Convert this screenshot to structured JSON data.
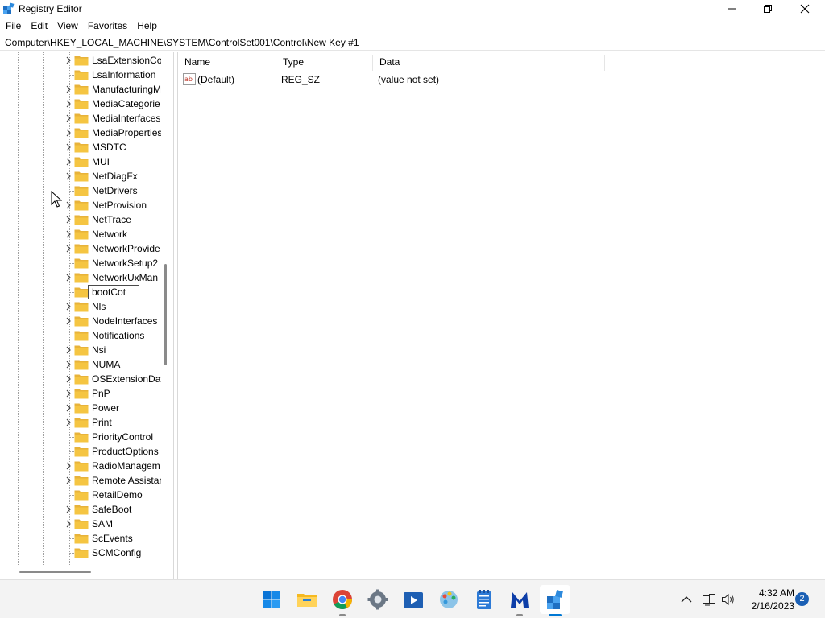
{
  "window": {
    "title": "Registry Editor",
    "minimize_icon": "minimize-icon",
    "maximize_icon": "restore-icon",
    "close_icon": "close-icon"
  },
  "menu": [
    "File",
    "Edit",
    "View",
    "Favorites",
    "Help"
  ],
  "address": "Computer\\HKEY_LOCAL_MACHINE\\SYSTEM\\ControlSet001\\Control\\New Key #1",
  "tree": {
    "items": [
      {
        "label": "LsaExtensionCo",
        "expandable": true
      },
      {
        "label": "LsaInformation",
        "expandable": false
      },
      {
        "label": "ManufacturingM",
        "expandable": true
      },
      {
        "label": "MediaCategorie",
        "expandable": true
      },
      {
        "label": "MediaInterfaces",
        "expandable": true
      },
      {
        "label": "MediaProperties",
        "expandable": true
      },
      {
        "label": "MSDTC",
        "expandable": true
      },
      {
        "label": "MUI",
        "expandable": true
      },
      {
        "label": "NetDiagFx",
        "expandable": true
      },
      {
        "label": "NetDrivers",
        "expandable": false
      },
      {
        "label": "NetProvision",
        "expandable": true
      },
      {
        "label": "NetTrace",
        "expandable": true
      },
      {
        "label": "Network",
        "expandable": true
      },
      {
        "label": "NetworkProvide",
        "expandable": true
      },
      {
        "label": "NetworkSetup2",
        "expandable": false
      },
      {
        "label": "NetworkUxMan",
        "expandable": true
      },
      {
        "label": "bootCot",
        "expandable": false,
        "editing": true
      },
      {
        "label": "Nls",
        "expandable": true
      },
      {
        "label": "NodeInterfaces",
        "expandable": true
      },
      {
        "label": "Notifications",
        "expandable": false
      },
      {
        "label": "Nsi",
        "expandable": true
      },
      {
        "label": "NUMA",
        "expandable": true
      },
      {
        "label": "OSExtensionDat",
        "expandable": true
      },
      {
        "label": "PnP",
        "expandable": true
      },
      {
        "label": "Power",
        "expandable": true
      },
      {
        "label": "Print",
        "expandable": true
      },
      {
        "label": "PriorityControl",
        "expandable": false
      },
      {
        "label": "ProductOptions",
        "expandable": false
      },
      {
        "label": "RadioManagem",
        "expandable": true
      },
      {
        "label": "Remote Assistar",
        "expandable": true
      },
      {
        "label": "RetailDemo",
        "expandable": false
      },
      {
        "label": "SafeBoot",
        "expandable": true
      },
      {
        "label": "SAM",
        "expandable": true
      },
      {
        "label": "ScEvents",
        "expandable": false
      },
      {
        "label": "SCMConfig",
        "expandable": false
      }
    ]
  },
  "values": {
    "columns": {
      "name": "Name",
      "type": "Type",
      "data": "Data"
    },
    "rows": [
      {
        "icon": "string-value-icon",
        "name": "(Default)",
        "type": "REG_SZ",
        "data": "(value not set)"
      }
    ]
  },
  "taskbar": {
    "apps": [
      {
        "name": "start-button",
        "icon": "windows-logo-icon"
      },
      {
        "name": "file-explorer",
        "icon": "folder-icon"
      },
      {
        "name": "chrome",
        "icon": "chrome-icon"
      },
      {
        "name": "settings",
        "icon": "gear-icon"
      },
      {
        "name": "media-player",
        "icon": "play-icon"
      },
      {
        "name": "paint",
        "icon": "palette-icon"
      },
      {
        "name": "notepad",
        "icon": "notepad-icon"
      },
      {
        "name": "malwarebytes",
        "icon": "malwarebytes-icon"
      },
      {
        "name": "registry-editor",
        "icon": "registry-icon"
      }
    ],
    "tray": {
      "chevron_icon": "chevron-up-icon",
      "network_icon": "network-icon",
      "volume_icon": "volume-icon"
    },
    "time": "4:32 AM",
    "date": "2/16/2023",
    "notification_count": "2"
  },
  "colors": {
    "folder": "#f5c542",
    "accent": "#0078d4",
    "taskbar": "#f3f3f3"
  }
}
